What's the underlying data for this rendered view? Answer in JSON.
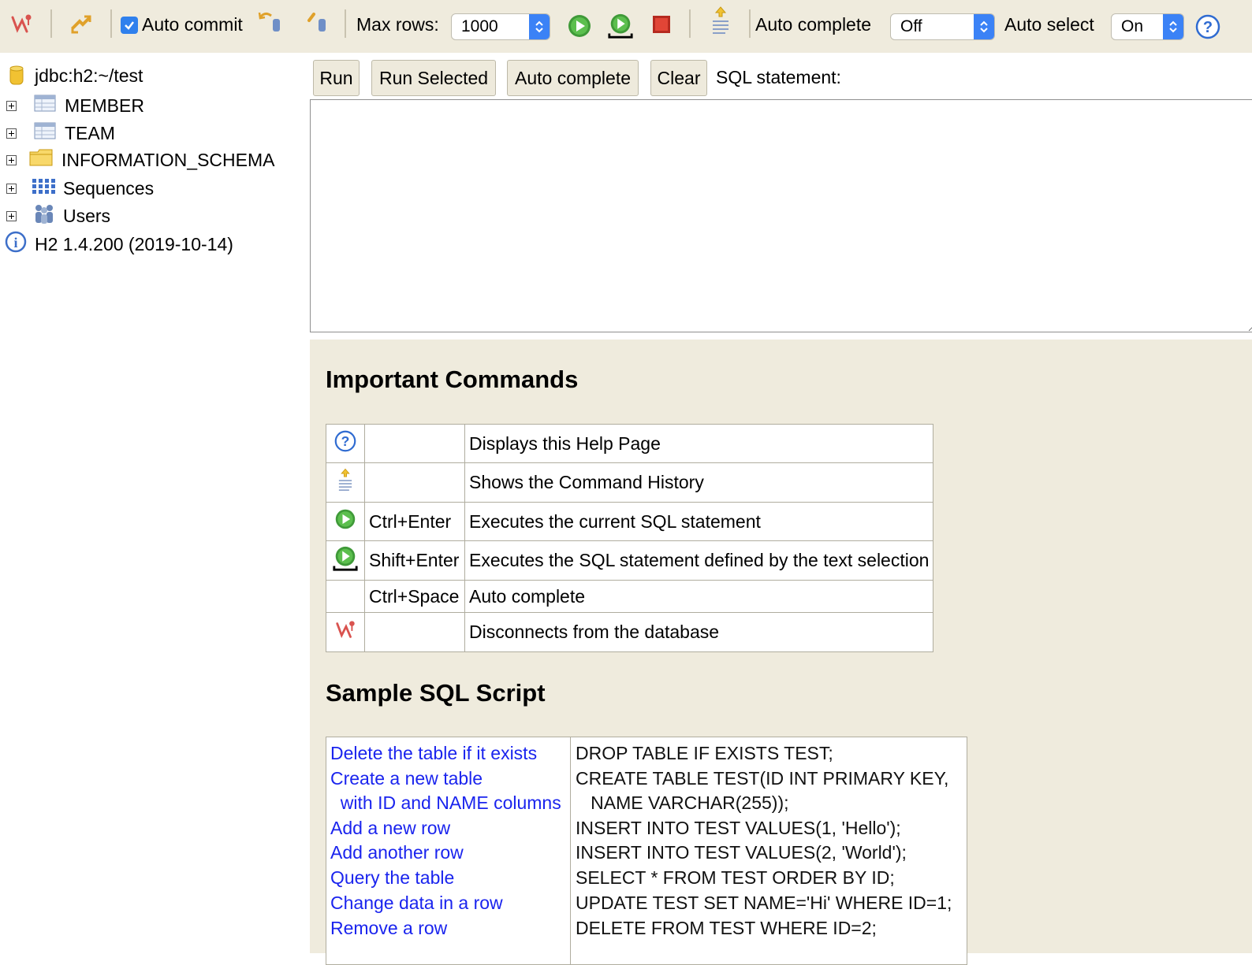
{
  "toolbar": {
    "auto_commit_label": "Auto commit",
    "auto_commit_checked": true,
    "max_rows_label": "Max rows:",
    "max_rows_value": "1000",
    "auto_complete_label": "Auto complete",
    "auto_complete_value": "Off",
    "auto_select_label": "Auto select",
    "auto_select_value": "On",
    "icons": [
      "disconnect-icon",
      "refresh-icon",
      "rollback-icon",
      "commit-icon",
      "run-icon",
      "run-selected-icon",
      "stop-icon",
      "history-icon",
      "help-icon"
    ]
  },
  "sidebar": {
    "connection": "jdbc:h2:~/test",
    "items": [
      {
        "label": "MEMBER",
        "icon": "table-icon"
      },
      {
        "label": "TEAM",
        "icon": "table-icon"
      },
      {
        "label": "INFORMATION_SCHEMA",
        "icon": "folder-icon"
      },
      {
        "label": "Sequences",
        "icon": "sequences-icon"
      },
      {
        "label": "Users",
        "icon": "users-icon"
      }
    ],
    "version": "H2 1.4.200 (2019-10-14)"
  },
  "query": {
    "buttons": {
      "run": "Run",
      "run_selected": "Run Selected",
      "auto_complete": "Auto complete",
      "clear": "Clear"
    },
    "sql_label": "SQL statement:",
    "sql_value": ""
  },
  "help": {
    "commands_title": "Important Commands",
    "commands": [
      {
        "icon": "help-icon",
        "shortcut": "",
        "description": "Displays this Help Page"
      },
      {
        "icon": "history-icon",
        "shortcut": "",
        "description": "Shows the Command History"
      },
      {
        "icon": "run-icon",
        "shortcut": "Ctrl+Enter",
        "description": "Executes the current SQL statement"
      },
      {
        "icon": "run-selected-icon",
        "shortcut": "Shift+Enter",
        "description": "Executes the SQL statement defined by the text selection"
      },
      {
        "icon": "",
        "shortcut": "Ctrl+Space",
        "description": "Auto complete"
      },
      {
        "icon": "disconnect-icon",
        "shortcut": "",
        "description": "Disconnects from the database"
      }
    ],
    "sample_title": "Sample SQL Script",
    "sample": {
      "links": [
        "Delete the table if it exists",
        "Create a new table",
        "  with ID and NAME columns",
        "Add a new row",
        "Add another row",
        "Query the table",
        "Change data in a row",
        "Remove a row"
      ],
      "code": [
        "DROP TABLE IF EXISTS TEST;",
        "CREATE TABLE TEST(ID INT PRIMARY KEY,",
        "   NAME VARCHAR(255));",
        "INSERT INTO TEST VALUES(1, 'Hello');",
        "INSERT INTO TEST VALUES(2, 'World');",
        "SELECT * FROM TEST ORDER BY ID;",
        "UPDATE TEST SET NAME='Hi' WHERE ID=1;",
        "DELETE FROM TEST WHERE ID=2;"
      ]
    }
  }
}
